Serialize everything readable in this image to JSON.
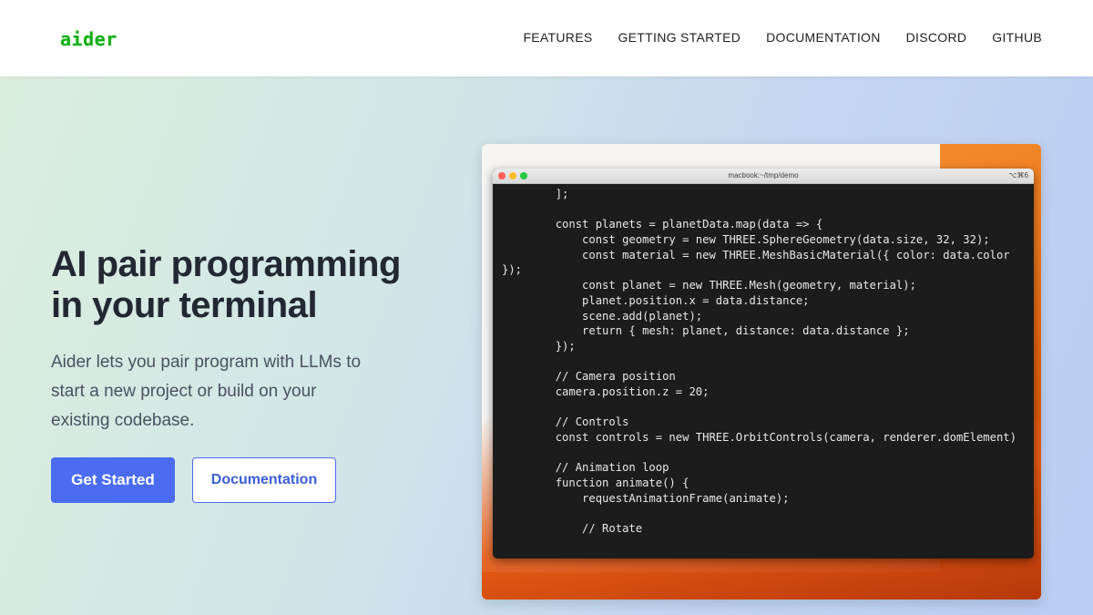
{
  "nav": {
    "logo": "aider",
    "links": [
      "FEATURES",
      "GETTING STARTED",
      "DOCUMENTATION",
      "DISCORD",
      "GITHUB"
    ]
  },
  "hero": {
    "title_line1": "AI pair programming",
    "title_line2": "in your terminal",
    "subtitle": "Aider lets you pair program with LLMs to start a new project or build on your existing codebase.",
    "primary_button": "Get Started",
    "secondary_button": "Documentation"
  },
  "terminal": {
    "title": "macbook:~/tmp/demo",
    "shortcut": "⌥⌘6",
    "lines": [
      "        ];",
      "",
      "        const planets = planetData.map(data => {",
      "            const geometry = new THREE.SphereGeometry(data.size, 32, 32);",
      "            const material = new THREE.MeshBasicMaterial({ color: data.color",
      "});",
      "            const planet = new THREE.Mesh(geometry, material);",
      "            planet.position.x = data.distance;",
      "            scene.add(planet);",
      "            return { mesh: planet, distance: data.distance };",
      "        });",
      "",
      "        // Camera position",
      "        camera.position.z = 20;",
      "",
      "        // Controls",
      "        const controls = new THREE.OrbitControls(camera, renderer.domElement)",
      "",
      "        // Animation loop",
      "        function animate() {",
      "            requestAnimationFrame(animate);",
      "",
      "            // Rotate"
    ]
  },
  "colors": {
    "logo_green": "#14b014",
    "primary_blue": "#4a6cf1",
    "terminal_bg": "#1c1c1c"
  }
}
